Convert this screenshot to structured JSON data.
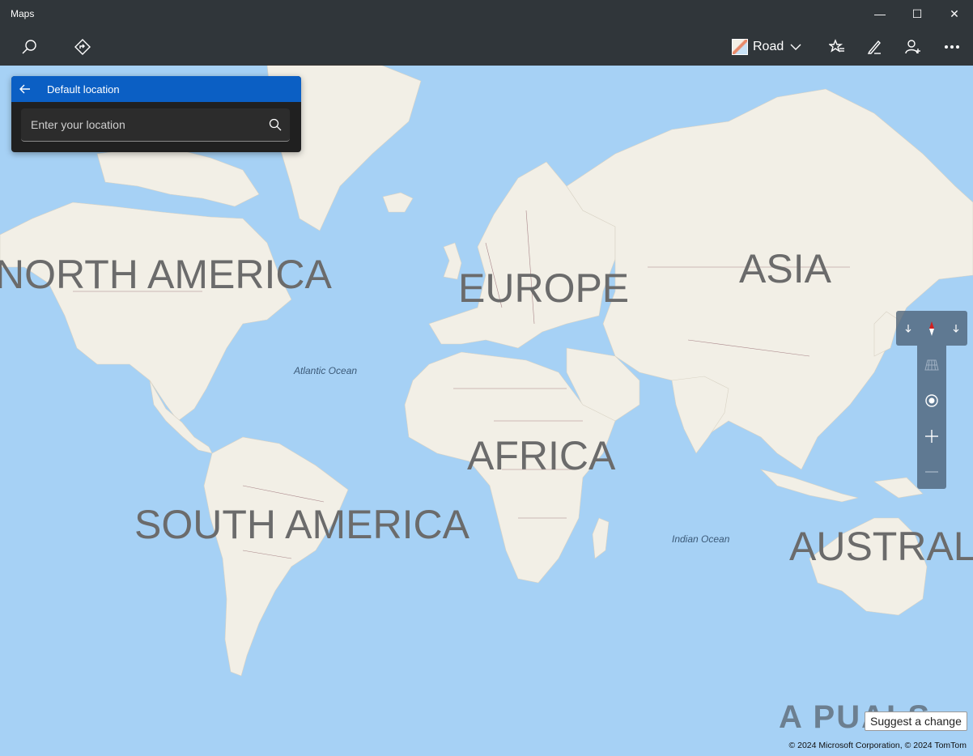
{
  "window": {
    "title": "Maps",
    "controls": {
      "minimize": "—",
      "maximize": "☐",
      "close": "✕"
    }
  },
  "toolbar": {
    "map_style": "Road",
    "icons": [
      "search-icon",
      "directions-icon",
      "favorites-icon",
      "ink-icon",
      "sign-in-icon",
      "more-icon"
    ]
  },
  "panel": {
    "title": "Default location",
    "placeholder": "Enter your location"
  },
  "map": {
    "continents": [
      "NORTH AMERICA",
      "EUROPE",
      "ASIA",
      "AFRICA",
      "SOUTH AMERICA",
      "AUSTRALIA"
    ],
    "oceans": [
      "Atlantic Ocean",
      "Indian Ocean"
    ],
    "colors": {
      "water": "#a6d1f5",
      "land": "#f2efe6",
      "borders": "#8a5a62",
      "label": "#6b6b6b"
    }
  },
  "controls": {
    "compass_icons": [
      "rotate-left-icon",
      "compass-icon",
      "rotate-right-icon"
    ],
    "stack_icons": [
      "tilt-icon",
      "location-icon",
      "zoom-in-icon",
      "zoom-out-icon"
    ]
  },
  "footer": {
    "watermark": "A PUALS",
    "suggest": "Suggest a change",
    "copyright": "© 2024 Microsoft Corporation, © 2024 TomTom"
  }
}
